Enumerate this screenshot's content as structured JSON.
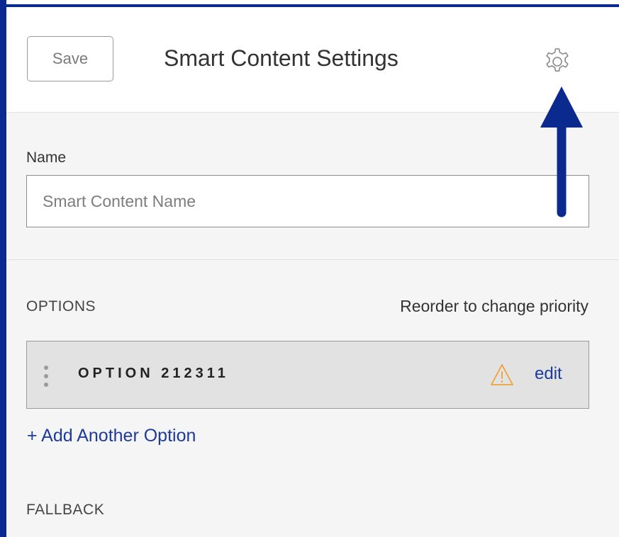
{
  "header": {
    "save_label": "Save",
    "title": "Smart Content Settings"
  },
  "name_section": {
    "label": "Name",
    "placeholder": "Smart Content Name"
  },
  "options_section": {
    "label": "OPTIONS",
    "hint": "Reorder to change priority",
    "items": [
      {
        "name": "OPTION 212311",
        "edit_label": "edit"
      }
    ],
    "add_label": "+ Add Another Option"
  },
  "fallback_section": {
    "label": "FALLBACK"
  },
  "icons": {
    "settings": "gear-icon",
    "warning": "warning-icon",
    "drag": "drag-handle-icon"
  },
  "colors": {
    "accent": "#1d3a9e",
    "annotation": "#0b2a8f",
    "warning": "#f0a23a",
    "row_background": "#e2e2e2",
    "panel_background": "#f5f5f5"
  }
}
